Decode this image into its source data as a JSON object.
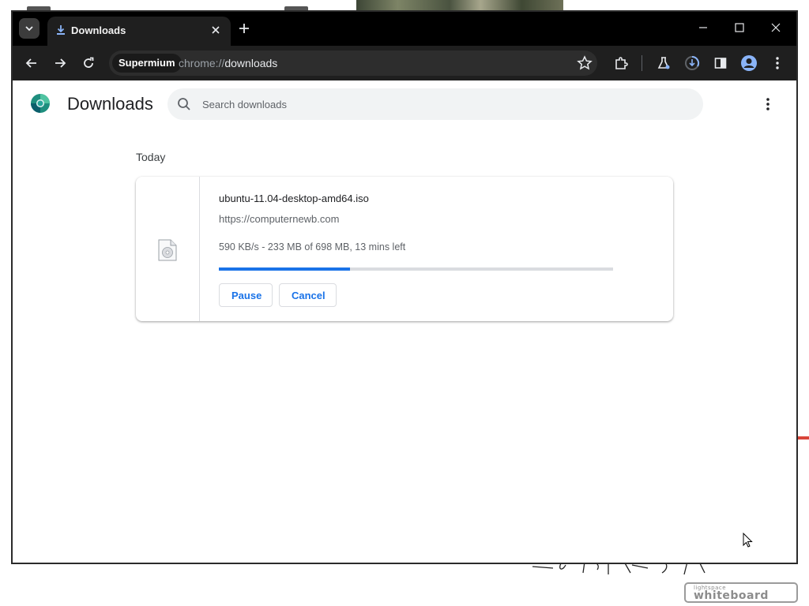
{
  "tab": {
    "title": "Downloads"
  },
  "toolbar": {
    "profile_chip": "Supermium",
    "url_scheme": "chrome://",
    "url_path": "downloads"
  },
  "page": {
    "title": "Downloads",
    "search_placeholder": "Search downloads"
  },
  "downloads": {
    "date_group": "Today",
    "items": [
      {
        "file_name": "ubuntu-11.04-desktop-amd64.iso",
        "source_url": "https://computernewb.com",
        "status": "590 KB/s - 233 MB of 698 MB, 13 mins left",
        "progress_fraction": 0.333,
        "pause_label": "Pause",
        "cancel_label": "Cancel"
      }
    ]
  },
  "branding": {
    "watermark": "lightspace whiteboard"
  },
  "colors": {
    "accent": "#1a73e8",
    "tab_strip": "#000000",
    "toolbar": "#1f1f1f"
  }
}
